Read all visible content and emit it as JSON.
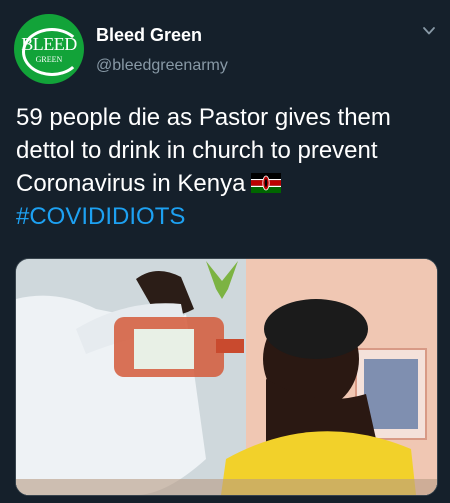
{
  "account": {
    "display_name": "Bleed Green",
    "handle": "@bleedgreenarmy",
    "avatar_logo_text": "BLEED",
    "avatar_logo_subtext": "GREEN"
  },
  "tweet": {
    "text": "59 people die as Pastor gives them dettol to drink in church to prevent Coronavirus in Kenya",
    "hashtag": "#COVIDIDIOTS"
  },
  "icons": {
    "menu": "chevron-down-icon",
    "flag": "kenya-flag-icon"
  },
  "colors": {
    "background": "#15202b",
    "text": "#ffffff",
    "secondary_text": "#8899a6",
    "hashtag": "#1da1f2",
    "avatar_bg": "#12a339"
  }
}
